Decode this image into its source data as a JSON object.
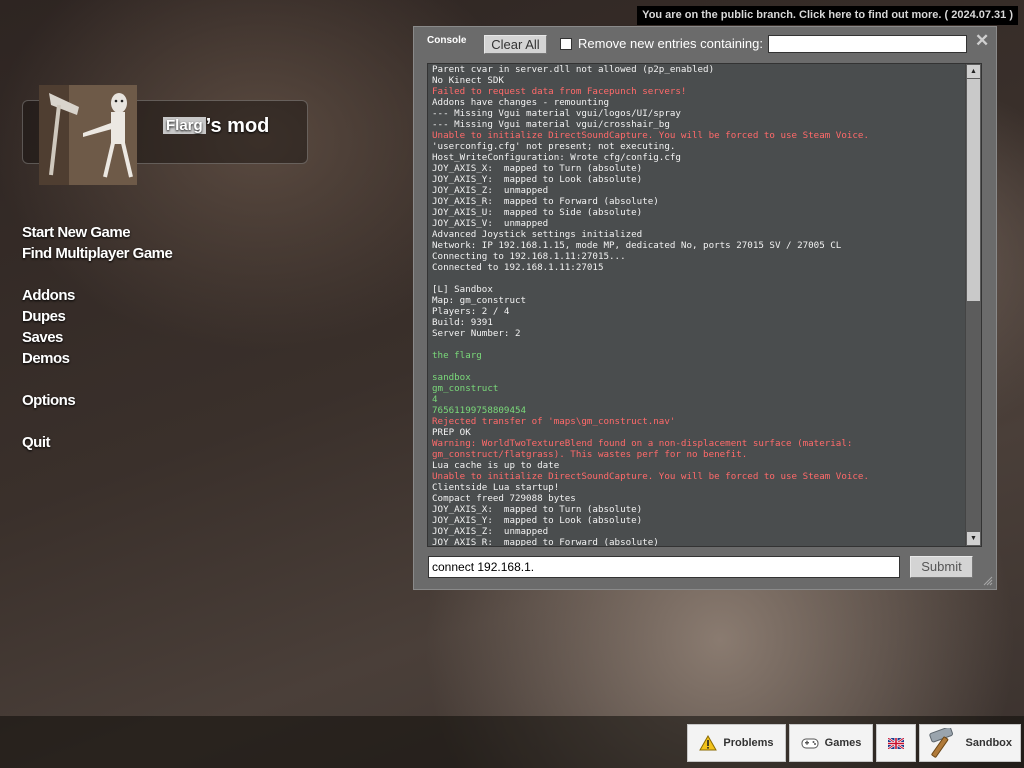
{
  "branch_banner": "You are on the public branch. Click here to find out more. ( 2024.07.31 )",
  "logo": {
    "highlight": "Flarg",
    "suffix": "’s mod"
  },
  "menu": {
    "start_new_game": "Start New Game",
    "find_multiplayer": "Find Multiplayer Game",
    "addons": "Addons",
    "dupes": "Dupes",
    "saves": "Saves",
    "demos": "Demos",
    "options": "Options",
    "quit": "Quit"
  },
  "console": {
    "title": "Console",
    "clear_all": "Clear All",
    "remove_entries_label": "Remove new entries containing:",
    "filter_value": "",
    "close_glyph": "✕",
    "command_value": "connect 192.168.1.",
    "submit": "Submit",
    "lines": [
      {
        "t": "Parent cvar in server.dll not allowed (p2p_enabled)",
        "c": "n"
      },
      {
        "t": "No Kinect SDK",
        "c": "n"
      },
      {
        "t": "Failed to request data from Facepunch servers!",
        "c": "e"
      },
      {
        "t": "Addons have changes - remounting",
        "c": "n"
      },
      {
        "t": "--- Missing Vgui material vgui/logos/UI/spray",
        "c": "n"
      },
      {
        "t": "--- Missing Vgui material vgui/crosshair_bg",
        "c": "n"
      },
      {
        "t": "Unable to initialize DirectSoundCapture. You will be forced to use Steam Voice.",
        "c": "e"
      },
      {
        "t": "'userconfig.cfg' not present; not executing.",
        "c": "n"
      },
      {
        "t": "Host_WriteConfiguration: Wrote cfg/config.cfg",
        "c": "n"
      },
      {
        "t": "JOY_AXIS_X:  mapped to Turn (absolute)",
        "c": "n"
      },
      {
        "t": "JOY_AXIS_Y:  mapped to Look (absolute)",
        "c": "n"
      },
      {
        "t": "JOY_AXIS_Z:  unmapped",
        "c": "n"
      },
      {
        "t": "JOY_AXIS_R:  mapped to Forward (absolute)",
        "c": "n"
      },
      {
        "t": "JOY_AXIS_U:  mapped to Side (absolute)",
        "c": "n"
      },
      {
        "t": "JOY_AXIS_V:  unmapped",
        "c": "n"
      },
      {
        "t": "Advanced Joystick settings initialized",
        "c": "n"
      },
      {
        "t": "Network: IP 192.168.1.15, mode MP, dedicated No, ports 27015 SV / 27005 CL",
        "c": "n"
      },
      {
        "t": "Connecting to 192.168.1.11:27015...",
        "c": "n"
      },
      {
        "t": "Connected to 192.168.1.11:27015",
        "c": "n"
      },
      {
        "t": "",
        "c": "n"
      },
      {
        "t": "[L] Sandbox",
        "c": "n"
      },
      {
        "t": "Map: gm_construct",
        "c": "n"
      },
      {
        "t": "Players: 2 / 4",
        "c": "n"
      },
      {
        "t": "Build: 9391",
        "c": "n"
      },
      {
        "t": "Server Number: 2",
        "c": "n"
      },
      {
        "t": "",
        "c": "n"
      },
      {
        "t": "the flarg",
        "c": "g"
      },
      {
        "t": "",
        "c": "n"
      },
      {
        "t": "sandbox",
        "c": "g"
      },
      {
        "t": "gm_construct",
        "c": "g"
      },
      {
        "t": "4",
        "c": "g"
      },
      {
        "t": "76561199758809454",
        "c": "g"
      },
      {
        "t": "Rejected transfer of 'maps\\gm_construct.nav'",
        "c": "e"
      },
      {
        "t": "PREP OK",
        "c": "n"
      },
      {
        "t": "Warning: WorldTwoTextureBlend found on a non-displacement surface (material:",
        "c": "e"
      },
      {
        "t": "gm_construct/flatgrass). This wastes perf for no benefit.",
        "c": "e"
      },
      {
        "t": "Lua cache is up to date",
        "c": "n"
      },
      {
        "t": "Unable to initialize DirectSoundCapture. You will be forced to use Steam Voice.",
        "c": "e"
      },
      {
        "t": "Clientside Lua startup!",
        "c": "n"
      },
      {
        "t": "Compact freed 729088 bytes",
        "c": "n"
      },
      {
        "t": "JOY_AXIS_X:  mapped to Turn (absolute)",
        "c": "n"
      },
      {
        "t": "JOY_AXIS_Y:  mapped to Look (absolute)",
        "c": "n"
      },
      {
        "t": "JOY_AXIS_Z:  unmapped",
        "c": "n"
      },
      {
        "t": "JOY_AXIS_R:  mapped to Forward (absolute)",
        "c": "n"
      }
    ]
  },
  "taskbar": {
    "problems": "Problems",
    "games": "Games",
    "sandbox": "Sandbox"
  },
  "colors": {
    "error": "#ff6a6a",
    "green": "#7ad97a",
    "console_bg": "#6b6b6b",
    "log_bg": "#4a4d4e"
  }
}
